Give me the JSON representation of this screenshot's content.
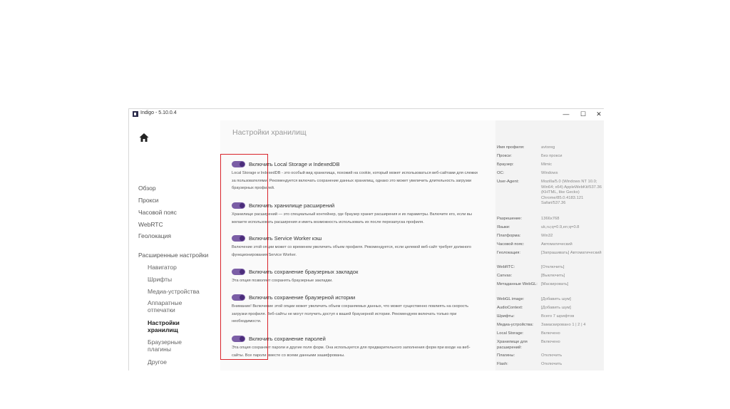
{
  "window": {
    "title": "Indigo - 5.10.0.4"
  },
  "titlebar": {
    "minimize": "—",
    "maximize": "☐",
    "close": "✕"
  },
  "sidebar": {
    "items": [
      "Обзор",
      "Прокси",
      "Часовой пояс",
      "WebRTC",
      "Геолокация"
    ],
    "advanced_header": "Расширенные настройки",
    "advanced_items": [
      "Навигатор",
      "Шрифты",
      "Медиа-устройства",
      "Аппаратные\nотпечатки",
      "Настройки\nхранилищ",
      "Браузерные\nплагины",
      "Другое"
    ],
    "active_item": "Настройки\nхранилищ"
  },
  "main": {
    "title": "Настройки хранилищ",
    "options": [
      {
        "label": "Включить Local Storage и IndexedDB",
        "enabled": true,
        "description": "Local Storage и IndexedDB - это особый вид хранилища, похожий на cookie, который может использоваться веб-сайтами для слежки за пользователями. Рекомендуется включать сохранение данных хранилищ, однако это может увеличить длительность загрузки браузерных профилей."
      },
      {
        "label": "Включить хранилище расширений",
        "enabled": true,
        "description": "Хранилище расширений — это специальный контейнер, где браузер хранит расширения и их параметры. Включите его, если вы желаете использовать расширения и иметь возможность использовать их после перезапуска профиля."
      },
      {
        "label": "Включить Service Worker кэш",
        "enabled": true,
        "description": "Включение этой опции может со временем увеличить объем профиля. Рекомендуется, если целевой веб-сайт требует должного функционирования Service Worker."
      },
      {
        "label": "Включить сохранение браузерных закладок",
        "enabled": true,
        "description": "Эта опция позволяет сохранять браузерные закладки."
      },
      {
        "label": "Включить сохранение браузерной истории",
        "enabled": true,
        "description": "Внимание! Включение этой опции может увеличить объем сохраняемых данных, что может существенно повлиять на скорость загрузки профиля. Веб-сайты не могут получить доступ к вашей браузерной истории. Рекомендуем включать только при необходимости."
      },
      {
        "label": "Включить сохранение паролей",
        "enabled": true,
        "description": "Эта опция сохраняет пароли и другие поля форм. Она используется для предварительного заполнения форм при входе на веб-сайты. Все пароли вместе со всеми данными зашифрованы."
      }
    ]
  },
  "info": {
    "rows": [
      {
        "key": "Имя профиля:",
        "value": "avtoreg"
      },
      {
        "key": "Прокси:",
        "value": "Без прокси"
      },
      {
        "key": "Браузер:",
        "value": "Mimic"
      },
      {
        "key": "ОС:",
        "value": "Windows"
      },
      {
        "key": "User-Agent:",
        "value": "Mozilla/5.0 (Windows NT 10.0; Win64; x64) AppleWebKit/537.36 (KHTML, like Gecko) Chrome/85.0.4183.121 Safari/537.36"
      },
      {
        "key": "Разрешение:",
        "value": "1366x768"
      },
      {
        "key": "Языки:",
        "value": "uk,ru;q=0.9,en;q=0.8"
      },
      {
        "key": "Платформа:",
        "value": "Win32"
      },
      {
        "key": "Часовой пояс:",
        "value": "Автоматический"
      },
      {
        "key": "Геолокация:",
        "value": "[Запрашивать] Автоматический"
      },
      {
        "key": "WebRTC:",
        "value": "[Отключить]"
      },
      {
        "key": "Canvas:",
        "value": "[Выключить]"
      },
      {
        "key": "Метаданные WebGL:",
        "value": "[Маскировать]"
      },
      {
        "key": "WebGL image:",
        "value": "[Добавить шум]"
      },
      {
        "key": "AudioContext:",
        "value": "[Добавить шум]"
      },
      {
        "key": "Шрифты:",
        "value": "Всего 7 шрифтов"
      },
      {
        "key": "Медиа-устройства:",
        "value": "Замаскировано 1 | 2 | 4"
      },
      {
        "key": "Local Storage:",
        "value": "Включено"
      },
      {
        "key": "Хранилище для расширений:",
        "value": "Включено"
      },
      {
        "key": "Плагины:",
        "value": "Отключить"
      },
      {
        "key": "Flash:",
        "value": "Отключить"
      }
    ]
  },
  "colors": {
    "toggle_on": "#7b5ea6",
    "highlight": "#d8232a"
  }
}
